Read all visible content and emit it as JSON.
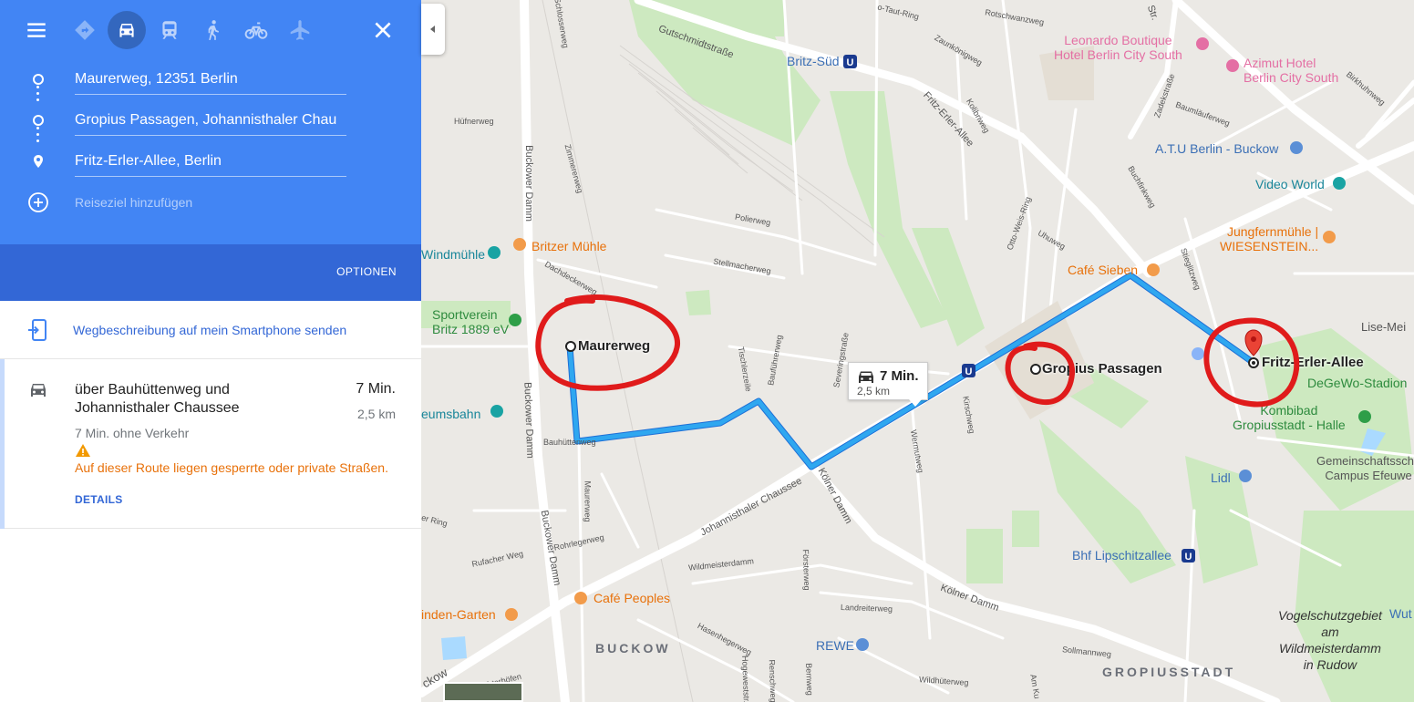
{
  "modes": {
    "menu": "menu-icon",
    "best": "directions-icon",
    "car": "car-icon",
    "transit": "train-icon",
    "walk": "walk-icon",
    "bike": "bicycle-icon",
    "flight": "airplane-icon",
    "close": "close-icon",
    "active_mode": "car"
  },
  "stops": [
    {
      "value": "Maurerweg, 12351 Berlin"
    },
    {
      "value": "Gropius Passagen, Johannisthaler Chau"
    },
    {
      "value": "Fritz-Erler-Allee, Berlin"
    }
  ],
  "add_stop": {
    "placeholder": "Reiseziel hinzufügen"
  },
  "options": {
    "label": "OPTIONEN"
  },
  "send": {
    "label": "Wegbeschreibung auf mein Smartphone senden"
  },
  "route": {
    "name": "über Bauhüttenweg und Johannisthaler Chaussee",
    "time": "7 Min.",
    "distance": "2,5 km",
    "traffic": "7 Min. ohne Verkehr",
    "warning": "Auf dieser Route liegen gesperrte oder private Straßen.",
    "details": "DETAILS"
  },
  "map": {
    "bubble": {
      "time": "7 Min.",
      "distance": "2,5 km"
    },
    "waypoints": {
      "a": "Maurerweg",
      "b": "Gropius Passagen",
      "c": "Fritz-Erler-Allee"
    },
    "pois": {
      "leonardo": "Leonardo Boutique\nHotel Berlin City South",
      "azimut": "Azimut Hotel\nBerlin City South",
      "atu": "A.T.U Berlin - Buckow",
      "video": "Video World",
      "jungfern": "Jungfernmühle |\nWIESENSTEIN...",
      "cafesieben": "Café Sieben",
      "britzer": "Britzer Mühle",
      "windmuhle": "Windmühle",
      "sportverein": "Sportverein\nBritz 1889 eV",
      "eumsbahn": "eumsbahn",
      "cafepeoples": "Café Peoples",
      "indengarten": "inden-Garten",
      "rewe": "REWE",
      "lidl": "Lidl",
      "kombibad": "Kombibad\nGropiusstadt - Halle",
      "degewo": "DeGeWo-Stadion",
      "lisemei": "Lise-Mei",
      "gemeinschaft": "Gemeinschaftsschu\nCampus Efeuwe",
      "vogel": "Vogelschutzgebiet\nam\nWildmeisterdamm\nin Rudow",
      "wut": "Wut",
      "britzsud": "Britz-Süd",
      "lipschitz": "Bhf Lipschitzallee",
      "buckow": "BUCKOW",
      "gropiusstadt": "GROPIUSSTADT",
      "ckow": "ckow"
    },
    "streets": {
      "gutschmidt": "Gutschmidtstraße",
      "fritzerler": "Fritz-Erler-Allee",
      "buckowerdamm1": "Buckower Damm",
      "buckowerdamm2": "Buckower Damm",
      "buckowerdamm3": "Buckower Damm",
      "johannisthaler": "Johannisthaler Chaussee",
      "kolner1": "Kölner Damm",
      "kolner2": "Kölner Damm",
      "bauhutten": "Bauhüttenweg",
      "rotschwanz": "Rotschwanzweg",
      "rohrleger": "Rohrlegerweg",
      "wildmeister": "Wildmeisterdamm",
      "rufacher": "Rufacher Weg",
      "landreiter": "Landreiterweg",
      "sollmann": "Sollmannweg",
      "wildhuter": "Wildhüterweg",
      "hasenheger": "Hasenhegerweg",
      "polier": "Polierweg",
      "stellmacher": "Stellmacherweg",
      "maurerweg": "Maurerweg",
      "hufner": "Hüfnerweg",
      "zimmerer": "Zimmererweg",
      "schlosser": "Schlosserweg",
      "dachdecker": "Dachdeckerweg",
      "severing": "Severingstraße",
      "tischler": "Tischlerzeile",
      "baufuhrer": "Bauführerweg",
      "otto": "Otto-Weis-Ring",
      "uhu": "Uhuweg",
      "wermut": "Wermutweg",
      "kirsch": "Kirschweg",
      "steglitz": "Stieglitzweg",
      "buchfink": "Buchfinkweg",
      "zaunkonig": "Zaunkönigweg",
      "kolibri": "Kolibriweg",
      "achterhof": "en Achterhöfen",
      "forster": "Försterweg",
      "hogewest": "Hogeweststr.",
      "ring": "er Ring",
      "str": "Str.",
      "taut": "o-Taut-Ring",
      "birkhuhn": "Birkhuhnweg",
      "bernweg": "Bernweg",
      "renschweg": "Renschweg",
      "amku": "Am Ku",
      "zadek": "Zadekstraße",
      "baumlaufer": "Baumläuferweg"
    }
  }
}
